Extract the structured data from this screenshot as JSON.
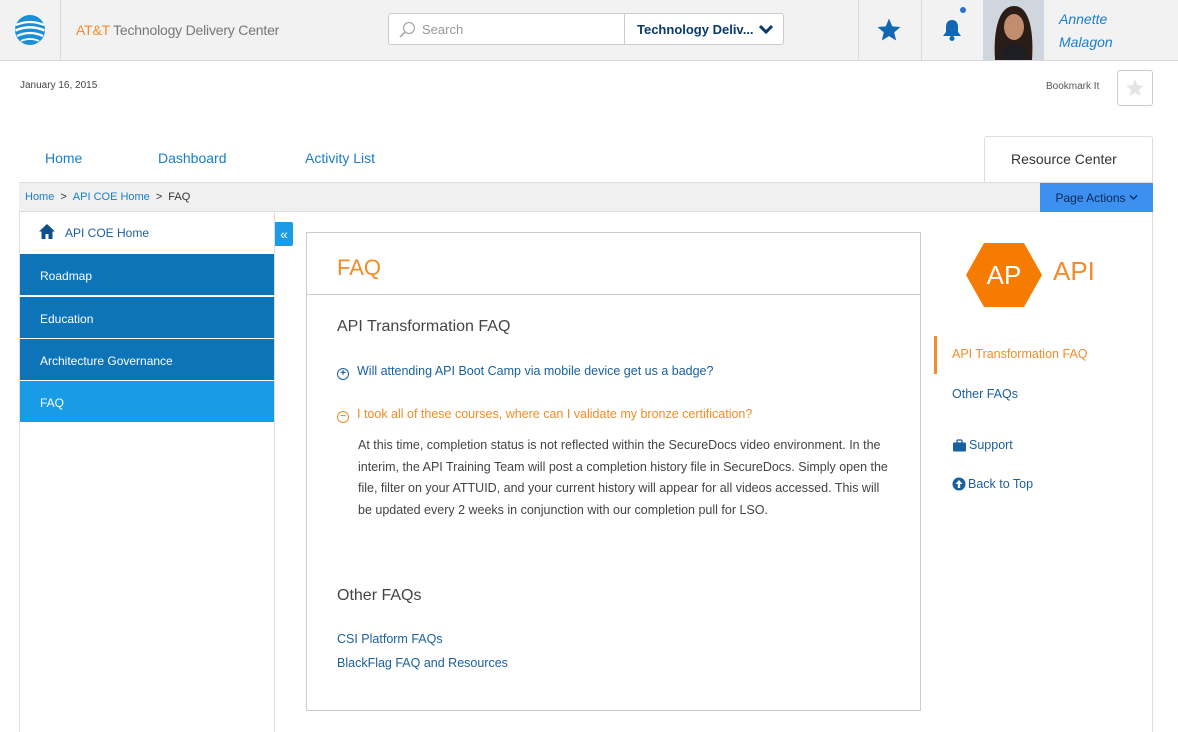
{
  "header": {
    "brand_prefix": "AT&T",
    "brand_rest": " Technology Delivery Center",
    "search_placeholder": "Search",
    "scope_value": "Technology Deliv...",
    "user_first": "Annette",
    "user_last": "Malagon"
  },
  "meta": {
    "date": "January 16, 2015",
    "bookmark_label": "Bookmark It"
  },
  "tabs": {
    "home": "Home",
    "dashboard": "Dashboard",
    "activity": "Activity List",
    "resource": "Resource Center"
  },
  "breadcrumb": {
    "items": [
      "Home",
      "API COE Home"
    ],
    "current": "FAQ",
    "separator": ">",
    "page_actions": "Page Actions"
  },
  "sidebar": {
    "home": "API COE Home",
    "items": [
      "Roadmap",
      "Education",
      "Architecture Governance",
      "FAQ"
    ],
    "active_index": 3,
    "collapse_glyph": "«"
  },
  "content": {
    "title": "FAQ",
    "section1_title": "API Transformation FAQ",
    "q1": "Will attending API Boot Camp via mobile device get us a badge?",
    "q2": "I took all of these courses, where can I validate my bronze certification?",
    "answer": "At this time, completion status is not reflected within the SecureDocs video environment. In the interim, the API Training Team will post a completion history file in SecureDocs. Simply open the file, filter on your ATTUID, and your current history will appear for all videos accessed. This will be updated every 2 weeks in conjunction with our completion pull for LSO.",
    "section2_title": "Other FAQs",
    "link1": "CSI Platform FAQs",
    "link2": "BlackFlag FAQ and Resources"
  },
  "right_panel": {
    "logo_badge": "AP",
    "logo_text": "API",
    "toc_active": "API Transformation FAQ",
    "toc_other": "Other FAQs",
    "support": "Support",
    "back_to_top": "Back to Top"
  },
  "colors": {
    "accent_orange": "#f28c28",
    "link_blue": "#1a5f9e",
    "sidebar_blue": "#0e74b8",
    "sidebar_active": "#1a9be6",
    "page_actions_bg": "#3d8ff0"
  }
}
